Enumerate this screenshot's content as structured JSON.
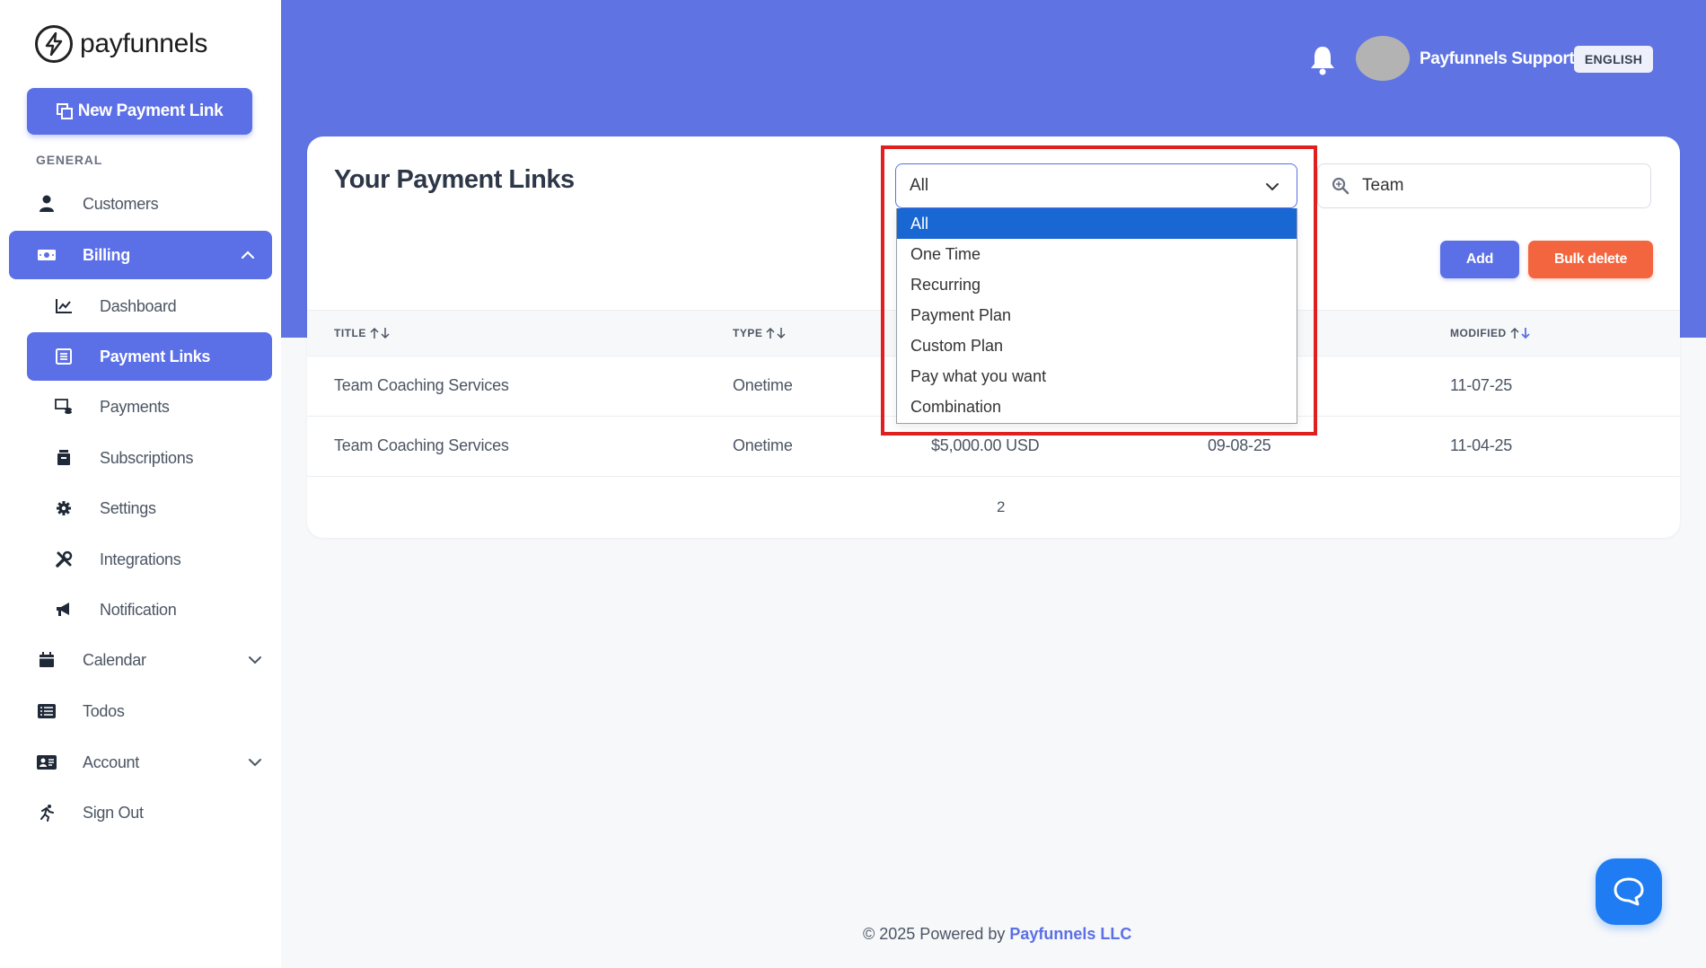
{
  "brand": {
    "name": "payfunnels"
  },
  "sidebar": {
    "new_link_label": "New Payment Link",
    "section_label": "GENERAL",
    "items": [
      {
        "label": "Customers",
        "icon": "user-icon"
      },
      {
        "label": "Billing",
        "icon": "money-icon"
      },
      {
        "label": "Dashboard",
        "icon": "chart-line-icon"
      },
      {
        "label": "Payment Links",
        "icon": "link-list-icon"
      },
      {
        "label": "Payments",
        "icon": "payments-icon"
      },
      {
        "label": "Subscriptions",
        "icon": "archive-icon"
      },
      {
        "label": "Settings",
        "icon": "gear-icon"
      },
      {
        "label": "Integrations",
        "icon": "tools-icon"
      },
      {
        "label": "Notification",
        "icon": "megaphone-icon"
      },
      {
        "label": "Calendar",
        "icon": "calendar-icon"
      },
      {
        "label": "Todos",
        "icon": "list-icon"
      },
      {
        "label": "Account",
        "icon": "id-card-icon"
      },
      {
        "label": "Sign Out",
        "icon": "running-icon"
      }
    ]
  },
  "header": {
    "user_name": "Payfunnels Support",
    "language": "ENGLISH"
  },
  "main": {
    "title": "Your Payment Links",
    "filter_value": "All",
    "search_value": "Team",
    "add_label": "Add",
    "bulk_delete_label": "Bulk delete",
    "columns": [
      "TITLE",
      "TYPE",
      "MODIFIED"
    ],
    "rows": [
      {
        "title": "Team Coaching Services",
        "type": "Onetime",
        "amount": "",
        "created": "",
        "modified": "11-07-25"
      },
      {
        "title": "Team Coaching Services",
        "type": "Onetime",
        "amount": "$5,000.00  USD",
        "created": "09-08-25",
        "modified": "11-04-25"
      }
    ],
    "page": "2"
  },
  "dropdown": {
    "options": [
      "All",
      "One Time",
      "Recurring",
      "Payment Plan",
      "Custom Plan",
      "Pay what you want",
      "Combination"
    ],
    "selected_index": 0
  },
  "footer": {
    "prefix": "© 2025 Powered by",
    "company": "Payfunnels LLC"
  },
  "colors": {
    "accent": "#5b6fe6",
    "danger": "#f3653f",
    "selection": "#1967d2",
    "highlight": "#e0201e"
  }
}
